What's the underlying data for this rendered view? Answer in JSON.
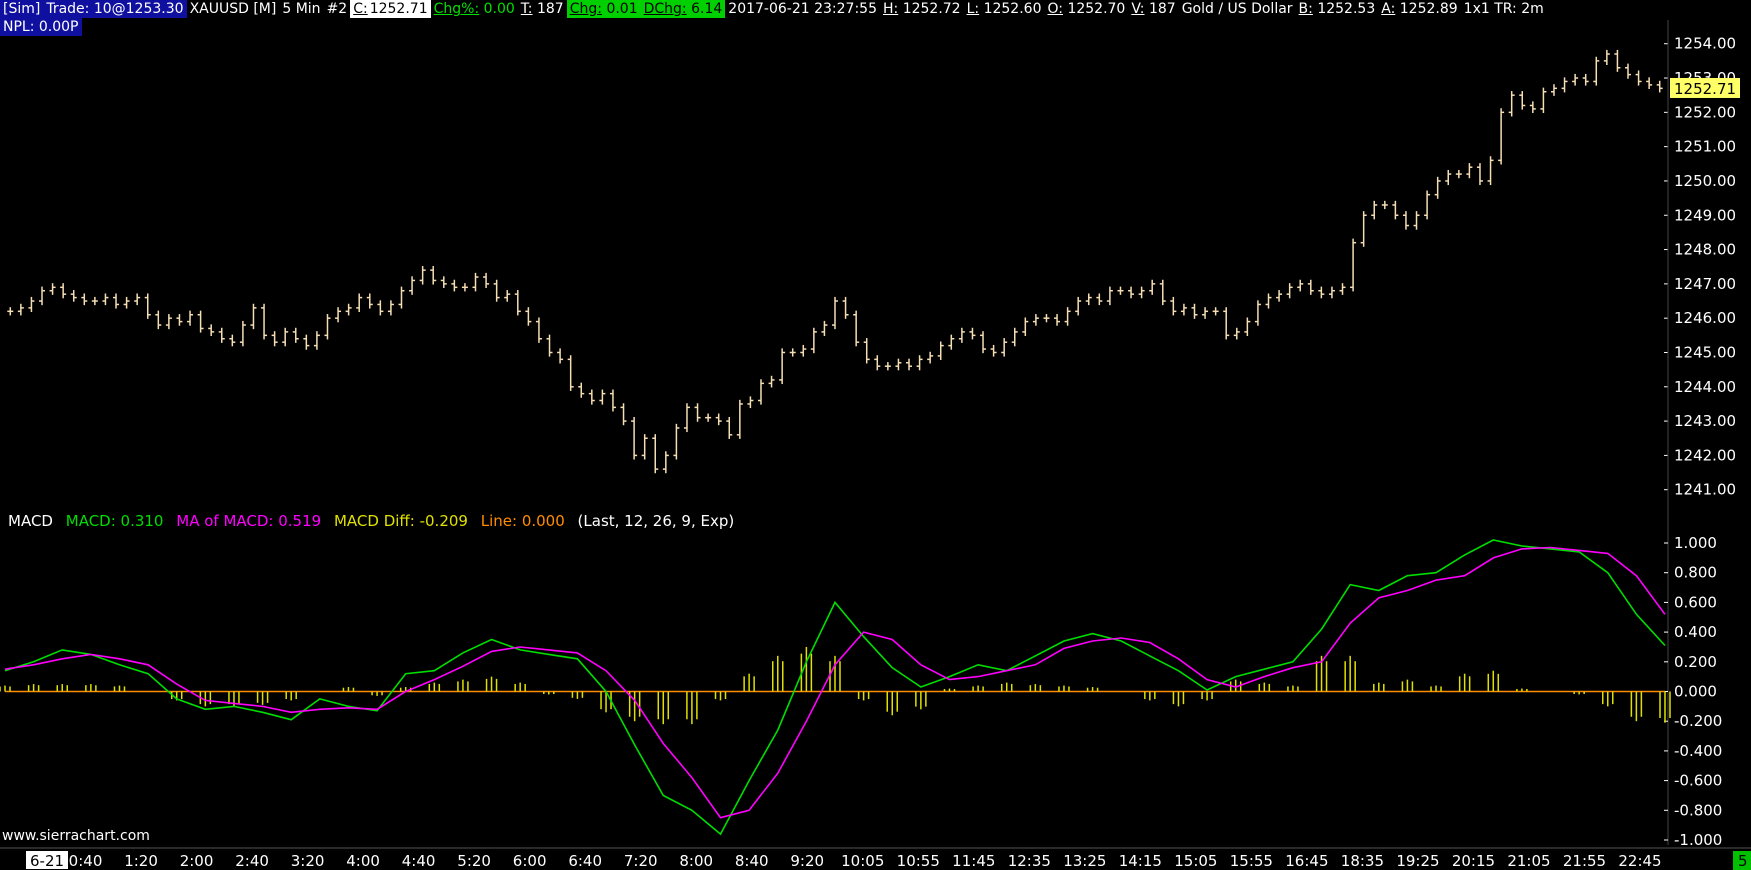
{
  "header": {
    "sim": "[Sim]",
    "trade": "Trade: 10@1253.30",
    "symbol": "XAUUSD [M]",
    "timeframe": "5 Min",
    "chart_num": "#2",
    "close_label": "C:",
    "close": "1252.71",
    "chgpct_label": "Chg%:",
    "chgpct": "0.00",
    "ticks_label": "T:",
    "ticks": "187",
    "chg_label": "Chg:",
    "chg": "0.01",
    "dchg_label": "DChg:",
    "dchg": "6.14",
    "datetime": "2017-06-21 23:27:55",
    "high_label": "H:",
    "high": "1252.72",
    "low_label": "L:",
    "low": "1252.60",
    "open_label": "O:",
    "open": "1252.70",
    "vol_label": "V:",
    "vol": "187",
    "desc": "Gold / US Dollar",
    "bid_label": "B:",
    "bid": "1252.53",
    "ask_label": "A:",
    "ask": "1252.89",
    "misc": "1x1 TR: 2m",
    "npl": "NPL: 0.00P"
  },
  "macd_legend": {
    "name": "MACD",
    "macd": "MACD: 0.310",
    "ma": "MA of MACD: 0.519",
    "diff": "MACD Diff: -0.209",
    "line": "Line: 0.000",
    "params": "(Last, 12, 26, 9, Exp)"
  },
  "watermark": "www.sierrachart.com",
  "footer_right": "5",
  "colors": {
    "bar": "#f5deb3",
    "macd": "#00dd00",
    "ma": "#ff00ff",
    "diff": "#e0e000",
    "zero": "#ff8c00",
    "axis": "#ffffff",
    "last_price_bg": "#ffff66"
  },
  "chart_data": [
    {
      "type": "ohlc",
      "title": "XAUUSD 5 Min",
      "ylim": [
        1240.7,
        1254.4
      ],
      "y_ticks": [
        "1254.00",
        "1253.00",
        "1252.00",
        "1251.00",
        "1250.00",
        "1249.00",
        "1248.00",
        "1247.00",
        "1246.00",
        "1245.00",
        "1244.00",
        "1243.00",
        "1242.00",
        "1241.00"
      ],
      "last_price": "1252.71",
      "closes": [
        1246.2,
        1246.3,
        1246.5,
        1246.8,
        1246.9,
        1246.7,
        1246.6,
        1246.5,
        1246.5,
        1246.6,
        1246.4,
        1246.5,
        1246.6,
        1246.1,
        1245.8,
        1246.0,
        1245.9,
        1246.1,
        1245.7,
        1245.6,
        1245.4,
        1245.3,
        1245.8,
        1246.3,
        1245.5,
        1245.3,
        1245.6,
        1245.4,
        1245.2,
        1245.5,
        1246.0,
        1246.2,
        1246.3,
        1246.6,
        1246.4,
        1246.2,
        1246.4,
        1246.8,
        1247.1,
        1247.4,
        1247.1,
        1247.0,
        1246.9,
        1246.9,
        1247.2,
        1247.0,
        1246.6,
        1246.7,
        1246.2,
        1245.9,
        1245.4,
        1245.0,
        1244.8,
        1244.0,
        1243.8,
        1243.6,
        1243.8,
        1243.4,
        1243.0,
        1242.0,
        1242.5,
        1241.6,
        1242.0,
        1242.8,
        1243.4,
        1243.1,
        1243.1,
        1243.0,
        1242.6,
        1243.5,
        1243.6,
        1244.1,
        1244.2,
        1245.0,
        1245.0,
        1245.1,
        1245.6,
        1245.8,
        1246.5,
        1246.1,
        1245.3,
        1244.8,
        1244.6,
        1244.6,
        1244.7,
        1244.6,
        1244.8,
        1244.9,
        1245.2,
        1245.4,
        1245.6,
        1245.5,
        1245.1,
        1245.0,
        1245.3,
        1245.6,
        1245.9,
        1246.0,
        1246.0,
        1245.9,
        1246.2,
        1246.5,
        1246.6,
        1246.5,
        1246.8,
        1246.8,
        1246.7,
        1246.8,
        1247.0,
        1246.5,
        1246.2,
        1246.3,
        1246.1,
        1246.2,
        1246.2,
        1245.5,
        1245.6,
        1245.9,
        1246.4,
        1246.6,
        1246.7,
        1246.9,
        1247.0,
        1246.8,
        1246.7,
        1246.8,
        1246.9,
        1248.2,
        1249.0,
        1249.3,
        1249.3,
        1249.0,
        1248.7,
        1249.0,
        1249.6,
        1250.0,
        1250.2,
        1250.2,
        1250.4,
        1250.0,
        1250.6,
        1252.0,
        1252.5,
        1252.2,
        1252.1,
        1252.6,
        1252.7,
        1252.9,
        1253.0,
        1252.9,
        1253.5,
        1253.7,
        1253.3,
        1253.1,
        1252.9,
        1252.8,
        1252.7
      ]
    },
    {
      "type": "line",
      "title": "MACD",
      "ylim": [
        -1.0,
        1.0
      ],
      "y_ticks": [
        "1.000",
        "0.800",
        "0.600",
        "0.400",
        "0.200",
        "0.000",
        "-0.200",
        "-0.400",
        "-0.600",
        "-0.800",
        "-1.000"
      ],
      "series": [
        {
          "name": "MACD",
          "values": [
            0.14,
            0.2,
            0.28,
            0.25,
            0.18,
            0.12,
            -0.05,
            -0.12,
            -0.1,
            -0.14,
            -0.19,
            -0.05,
            -0.1,
            -0.13,
            0.12,
            0.14,
            0.26,
            0.35,
            0.28,
            0.25,
            0.22,
            0.0,
            -0.36,
            -0.7,
            -0.8,
            -0.96,
            -0.6,
            -0.26,
            0.2,
            0.6,
            0.37,
            0.16,
            0.03,
            0.1,
            0.18,
            0.14,
            0.24,
            0.34,
            0.39,
            0.34,
            0.24,
            0.14,
            0.01,
            0.1,
            0.15,
            0.2,
            0.42,
            0.72,
            0.68,
            0.78,
            0.8,
            0.92,
            1.02,
            0.98,
            0.96,
            0.94,
            0.8,
            0.52,
            0.31
          ]
        },
        {
          "name": "MA of MACD",
          "values": [
            0.15,
            0.18,
            0.22,
            0.25,
            0.22,
            0.18,
            0.05,
            -0.06,
            -0.08,
            -0.1,
            -0.14,
            -0.12,
            -0.11,
            -0.12,
            0.0,
            0.08,
            0.17,
            0.27,
            0.3,
            0.28,
            0.26,
            0.14,
            -0.06,
            -0.35,
            -0.58,
            -0.85,
            -0.8,
            -0.55,
            -0.2,
            0.18,
            0.4,
            0.35,
            0.18,
            0.08,
            0.1,
            0.14,
            0.18,
            0.29,
            0.34,
            0.36,
            0.33,
            0.22,
            0.08,
            0.03,
            0.1,
            0.16,
            0.2,
            0.46,
            0.63,
            0.68,
            0.75,
            0.78,
            0.9,
            0.96,
            0.97,
            0.95,
            0.93,
            0.78,
            0.52
          ]
        },
        {
          "name": "MACD Diff",
          "values": [
            0.04,
            0.05,
            0.05,
            0.05,
            0.04,
            0.0,
            -0.06,
            -0.1,
            -0.1,
            -0.09,
            -0.06,
            0.0,
            0.03,
            -0.03,
            0.03,
            0.06,
            0.08,
            0.1,
            0.06,
            -0.02,
            -0.05,
            -0.14,
            -0.2,
            -0.22,
            -0.22,
            -0.06,
            0.12,
            0.24,
            0.3,
            0.24,
            -0.06,
            -0.16,
            -0.12,
            0.02,
            0.04,
            0.06,
            0.05,
            0.04,
            0.03,
            0.0,
            -0.06,
            -0.1,
            -0.06,
            0.08,
            0.06,
            0.04,
            0.24,
            0.24,
            0.06,
            0.08,
            0.04,
            0.12,
            0.14,
            0.02,
            0.0,
            -0.02,
            -0.1,
            -0.2,
            -0.21
          ]
        }
      ]
    }
  ],
  "x_labels": [
    "6-21",
    "0:40",
    "1:20",
    "2:00",
    "2:40",
    "3:20",
    "4:00",
    "4:40",
    "5:20",
    "6:00",
    "6:40",
    "7:20",
    "8:00",
    "8:40",
    "9:20",
    "10:05",
    "10:55",
    "11:45",
    "12:35",
    "13:25",
    "14:15",
    "15:05",
    "15:55",
    "16:45",
    "18:35",
    "19:25",
    "20:15",
    "21:05",
    "21:55",
    "22:45"
  ]
}
